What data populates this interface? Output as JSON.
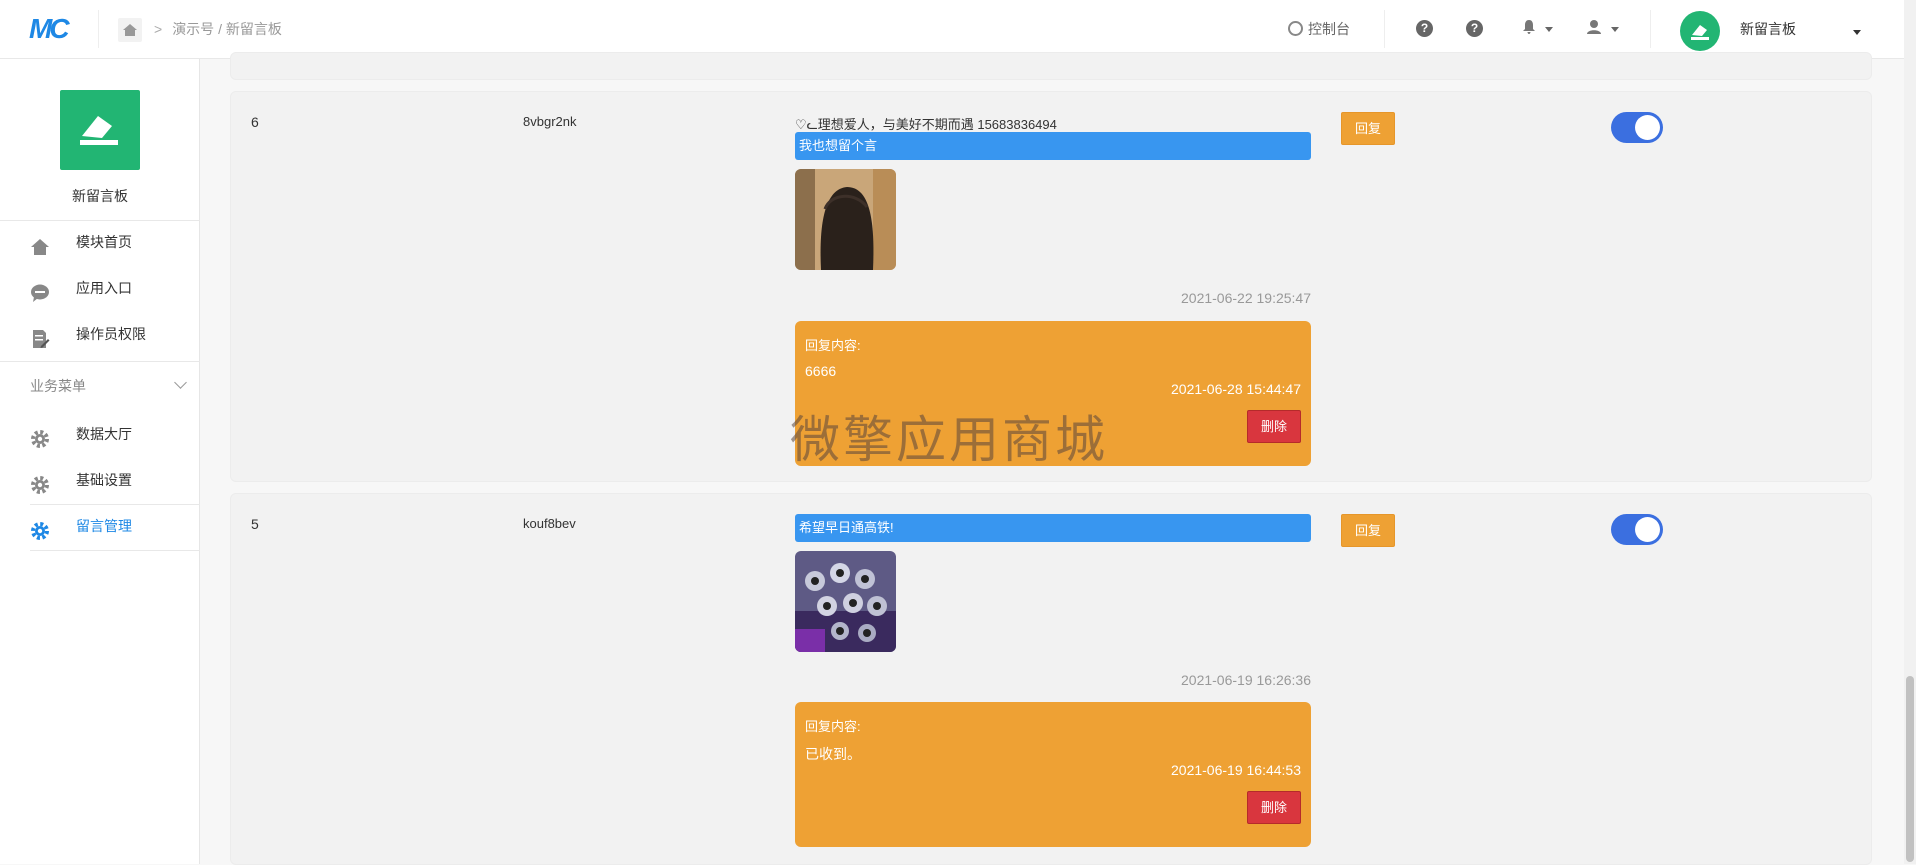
{
  "brand": {
    "logo_text": "MC"
  },
  "breadcrumb": {
    "path": "演示号 / 新留言板"
  },
  "topbar": {
    "console_label": "控制台",
    "module_name": "新留言板"
  },
  "sidebar": {
    "app_name": "新留言板",
    "items": [
      {
        "label": "模块首页",
        "icon": "home-icon"
      },
      {
        "label": "应用入口",
        "icon": "chat-icon"
      },
      {
        "label": "操作员权限",
        "icon": "doc-edit-icon"
      }
    ],
    "section_label": "业务菜单",
    "biz_items": [
      {
        "label": "数据大厅",
        "icon": "gear-icon"
      },
      {
        "label": "基础设置",
        "icon": "gear-icon"
      },
      {
        "label": "留言管理",
        "icon": "gear-icon",
        "active": true
      }
    ]
  },
  "rows": [
    {
      "id": "6",
      "nickname": "8vbgr2nk",
      "user_line": "♡ᓚ理想爱人，与美好不期而遇 15683836494",
      "message": "我也想留个言",
      "time": "2021-06-22 19:25:47",
      "reply_header": "回复内容:",
      "reply_content": "6666",
      "reply_time": "2021-06-28 15:44:47",
      "delete_label": "删除",
      "reply_button": "回复",
      "enabled": true
    },
    {
      "id": "5",
      "nickname": "kouf8bev",
      "user_line": "",
      "message": "希望早日通高铁!",
      "time": "2021-06-19 16:26:36",
      "reply_header": "回复内容:",
      "reply_content": "已收到。",
      "reply_time": "2021-06-19 16:44:53",
      "delete_label": "删除",
      "reply_button": "回复",
      "enabled": true
    }
  ],
  "watermark": "微擎应用商城",
  "colors": {
    "primary": "#1e88e5",
    "brand_green": "#22b573",
    "reply_orange": "#eea134",
    "message_blue": "#3896f0",
    "danger": "#d9363e",
    "toggle_on": "#3b6fe0"
  }
}
